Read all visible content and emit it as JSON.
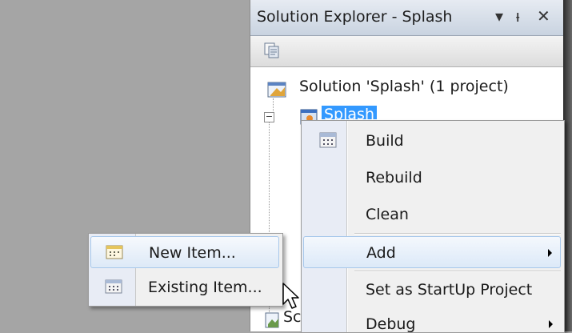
{
  "panel": {
    "title": "Solution Explorer - Splash",
    "dropdown_icon": "dropdown-arrow-icon",
    "pin_icon": "pin-icon",
    "close_icon": "close-icon",
    "toolbar_icon": "properties-icon"
  },
  "tree": {
    "solution_label": "Solution 'Splash' (1 project)",
    "project_label": "Splash",
    "partial_item_label": "Sc"
  },
  "context_menu": {
    "items": [
      {
        "label": "Build",
        "icon": "build-icon"
      },
      {
        "label": "Rebuild"
      },
      {
        "label": "Clean"
      },
      {
        "label": "Add",
        "has_submenu": true,
        "highlighted": true
      },
      {
        "label": "Set as StartUp Project"
      },
      {
        "label": "Debug",
        "has_submenu": true
      }
    ]
  },
  "submenu": {
    "items": [
      {
        "label": "New Item...",
        "icon": "new-item-icon",
        "highlighted": true
      },
      {
        "label": "Existing Item...",
        "icon": "existing-item-icon"
      }
    ]
  },
  "colors": {
    "selection": "#3399ff",
    "menu_highlight": "#dce9f8",
    "background": "#a5a5a5"
  }
}
